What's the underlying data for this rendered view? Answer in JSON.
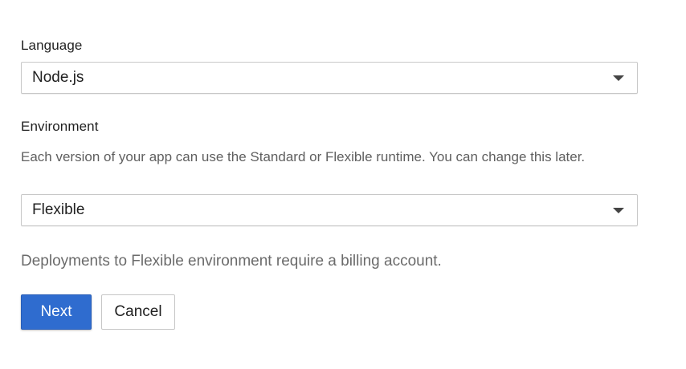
{
  "language": {
    "label": "Language",
    "selected": "Node.js"
  },
  "environment": {
    "label": "Environment",
    "description": "Each version of your app can use the Standard or Flexible runtime. You can change this later.",
    "selected": "Flexible"
  },
  "billing_note": "Deployments to Flexible environment require a billing account.",
  "actions": {
    "next_label": "Next",
    "cancel_label": "Cancel"
  },
  "colors": {
    "primary_button": "#2f6ccf",
    "help_text": "#5f5f5f"
  },
  "icons": {
    "dropdown": "caret-down-icon"
  }
}
